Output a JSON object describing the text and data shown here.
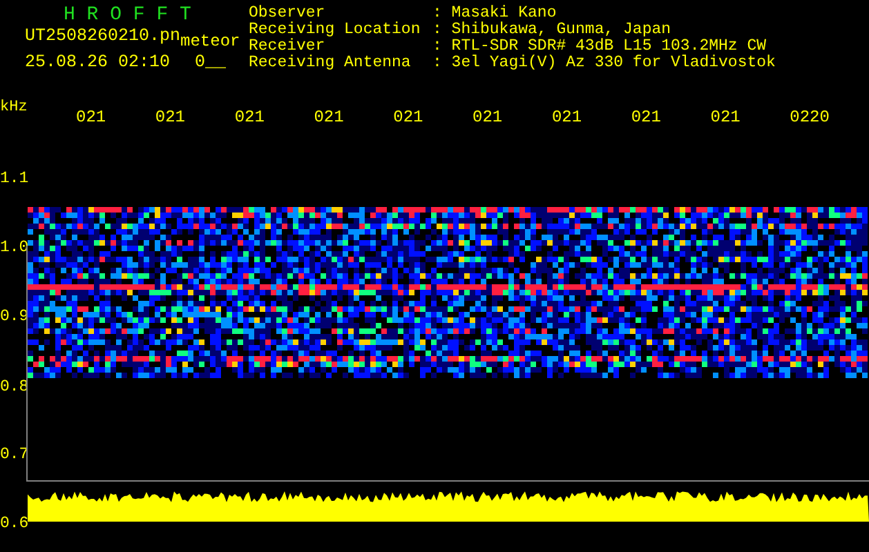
{
  "header": {
    "title": "H R O F F T",
    "file_name": "UT2508260210.pn",
    "file_tag": "meteor",
    "timestamp": "25.08.26 02:10",
    "counter": "0__"
  },
  "info": [
    {
      "label": "Observer",
      "value": ": Masaki Kano"
    },
    {
      "label": "Receiving Location",
      "value": ": Shibukawa, Gunma, Japan"
    },
    {
      "label": "Receiver",
      "value": ": RTL-SDR SDR# 43dB L15 103.2MHz CW"
    },
    {
      "label": "Receiving Antenna",
      "value": ": 3el Yagi(V) Az 330 for Vladivostok"
    }
  ],
  "axis": {
    "unit": "kHz",
    "time_labels": [
      "021",
      "021",
      "021",
      "021",
      "021",
      "021",
      "021",
      "021",
      "021",
      "0220"
    ],
    "freq_labels": [
      "1.1",
      "1.0",
      "0.9",
      "0.8",
      "0.7",
      "0.6"
    ]
  }
}
